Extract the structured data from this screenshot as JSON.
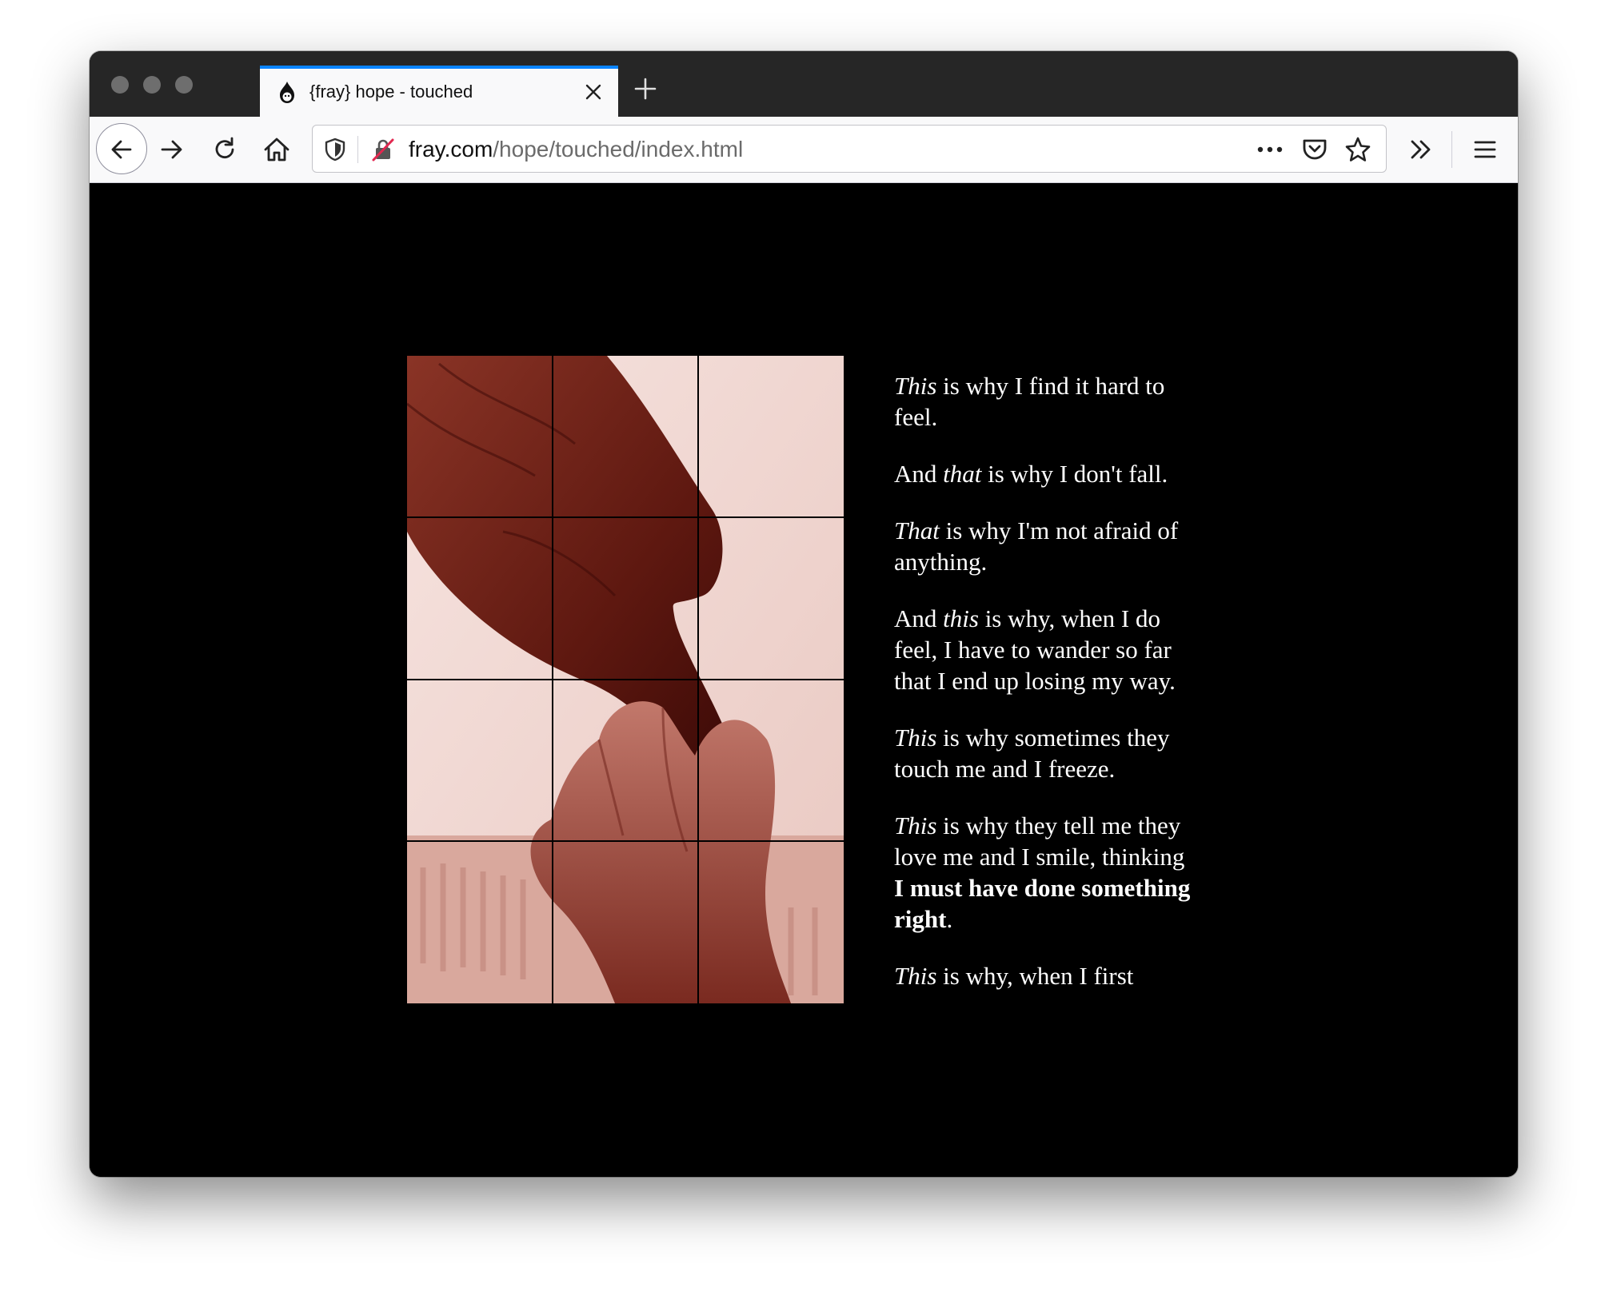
{
  "browser": {
    "tab_title": "{fray} hope - touched",
    "url_host": "fray.com",
    "url_path": "/hope/touched/index.html"
  },
  "colors": {
    "accent": "#0a84ff",
    "titlebar": "#262626",
    "toolbar": "#f9f9fa",
    "page_background": "#000000",
    "text": "#ffffff"
  },
  "icons": {
    "tab_favicon": "fray-logo-icon",
    "tab_close": "close-icon",
    "new_tab": "plus-icon",
    "back": "arrow-left-icon",
    "forward": "arrow-right-icon",
    "reload": "reload-icon",
    "home": "home-icon",
    "tracking": "shield-icon",
    "insecure": "insecure-lock-icon",
    "page_actions": "more-icon",
    "pocket": "pocket-icon",
    "bookmark": "star-icon",
    "overflow": "chevron-double-right-icon",
    "menu": "hamburger-menu-icon"
  },
  "page": {
    "image_alt": "hands",
    "poem": [
      [
        {
          "t": "This",
          "s": "i"
        },
        {
          "t": " is why I find it hard to feel."
        }
      ],
      [
        {
          "t": "And "
        },
        {
          "t": "that",
          "s": "i"
        },
        {
          "t": " is why I don't fall."
        }
      ],
      [
        {
          "t": "That",
          "s": "i"
        },
        {
          "t": " is why I'm not afraid of anything."
        }
      ],
      [
        {
          "t": "And "
        },
        {
          "t": "this",
          "s": "i"
        },
        {
          "t": " is why, when I do feel, I have to wander so far that I end up losing my way."
        }
      ],
      [
        {
          "t": "This",
          "s": "i"
        },
        {
          "t": " is why sometimes they touch me and I freeze."
        }
      ],
      [
        {
          "t": "This",
          "s": "i"
        },
        {
          "t": " is why they tell me they love me and I smile, thinking "
        },
        {
          "t": "I must have done something right",
          "s": "b"
        },
        {
          "t": "."
        }
      ],
      [
        {
          "t": "This",
          "s": "i"
        },
        {
          "t": " is why, when I first"
        }
      ]
    ]
  }
}
